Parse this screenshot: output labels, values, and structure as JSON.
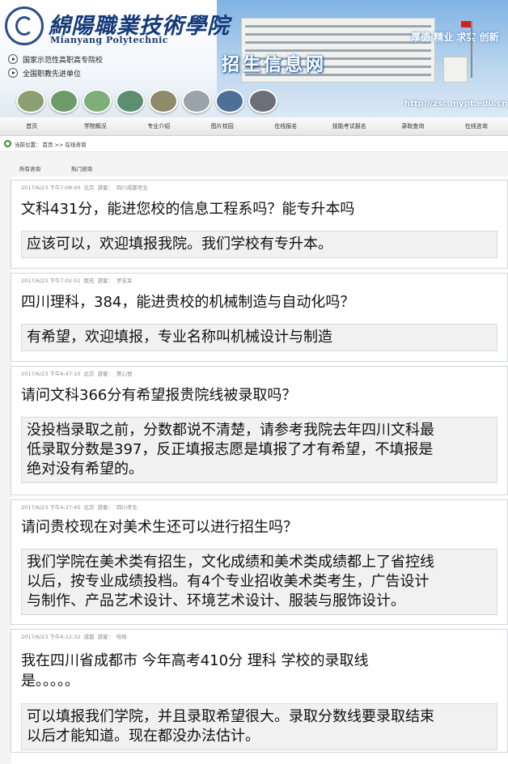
{
  "header": {
    "school_name_cn": "綿陽職業技術學院",
    "school_name_en": "Mianyang Polytechnic",
    "honors": [
      "国家示范性高职高专院校",
      "全国职教先进单位"
    ],
    "section_title": "招生信息网",
    "slogans": [
      "厚德",
      "精业",
      "求实",
      "创新"
    ],
    "url": "http://zsc.mypt.edu.cn"
  },
  "nav": {
    "items": [
      "首页",
      "学院概况",
      "专业介绍",
      "图片校园",
      "在线报名",
      "技能考试报名",
      "录取查询",
      "在线咨询"
    ]
  },
  "breadcrumb": {
    "label": "当前位置：",
    "home": "首页",
    "separator": ">>",
    "current": "在线咨询"
  },
  "tabs": [
    "所有咨询",
    "热门咨询"
  ],
  "consultations": [
    {
      "datetime": "2017/6/23 下午7:08:40",
      "location": "北京",
      "visitor_label": "游客：",
      "visitor": "四川成都考生",
      "question": "文科431分，能进您校的信息工程系吗？能专升本吗",
      "answer": "应该可以，欢迎填报我院。我们学校有专升本。"
    },
    {
      "datetime": "2017/6/23 下午7:02:51",
      "location": "南充",
      "visitor_label": "游客：",
      "visitor": "罗志军",
      "question": "四川理科，384，能进贵校的机械制造与自动化吗？",
      "answer": "有希望，欢迎填报，专业名称叫机械设计与制造"
    },
    {
      "datetime": "2017/6/23 下午6:47:10",
      "location": "北京",
      "visitor_label": "游客：",
      "visitor": "樊心悦",
      "question": "请问文科366分有希望报贵院线被录取吗？",
      "answer_lines": [
        "没投档录取之前，分数都说不清楚，请参考我院去年四川文科最",
        "低录取分数是397，反正填报志愿是填报了才有希望，不填报是",
        "绝对没有希望的。"
      ]
    },
    {
      "datetime": "2017/6/23 下午4:37:45",
      "location": "北京",
      "visitor_label": "游客：",
      "visitor": "四川考生",
      "question": "请问贵校现在对美术生还可以进行招生吗？",
      "answer_lines": [
        "我们学院在美术类有招生，文化成绩和美术类成绩都上了省控线",
        "以后，按专业成绩投档。有4个专业招收美术类考生，广告设计",
        "与制作、产品艺术设计、环境艺术设计、服装与服饰设计。"
      ]
    },
    {
      "datetime": "2017/6/23 下午6:12:32",
      "location": "成都",
      "visitor_label": "游客：",
      "visitor": "哈哈",
      "question_lines": [
        "我在四川省成都市 今年高考410分 理科 学校的录取线",
        "是。。。。。"
      ],
      "answer_lines": [
        "可以填报我们学院，并且录取希望很大。录取分数线要录取结束",
        "以后才能知道。现在都没办法估计。"
      ]
    }
  ],
  "colors": {
    "brand_blue": "#153a78",
    "sky_blue": "#7fb3e3",
    "answer_bg": "#f1f1f1",
    "card_border": "#cfd6dc"
  }
}
